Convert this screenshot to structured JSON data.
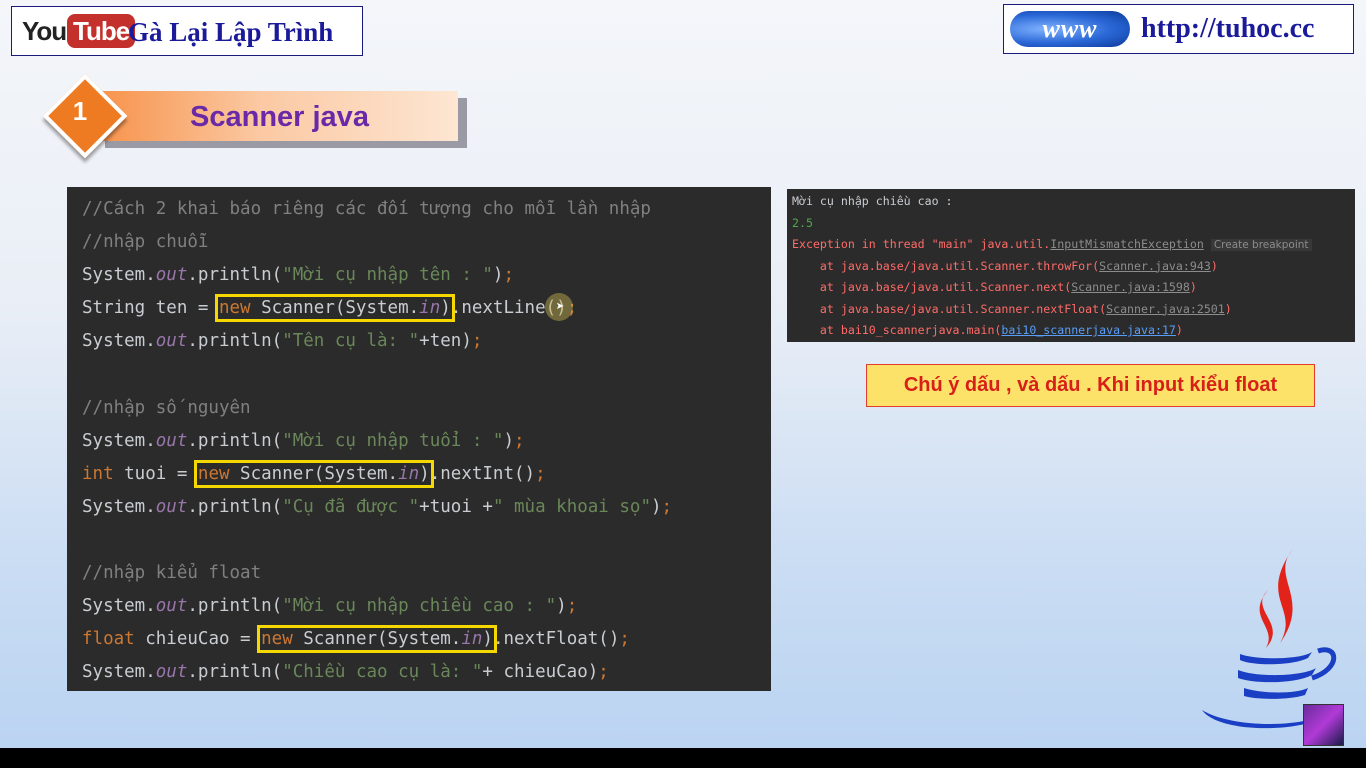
{
  "header": {
    "youtube_you": "You",
    "youtube_tube": "Tube",
    "channel_name": "Gà Lại Lập Trình",
    "www_logo": "www",
    "website_url": "http://tuhoc.cc"
  },
  "badge": {
    "number": "1",
    "title": "Scanner java"
  },
  "code": {
    "lines": [
      "//Cách 2 khai báo riêng các đối tượng cho mỗi lần nhập",
      "//nhập chuỗi",
      "System.out.println(\"Mời cụ nhập tên : \");",
      "String ten = new Scanner(System.in).nextLine();",
      "System.out.println(\"Tên cụ là: \"+ten);",
      "",
      "//nhập số nguyên",
      "System.out.println(\"Mời cụ nhập tuổi : \");",
      "int tuoi = new Scanner(System.in).nextInt();",
      "System.out.println(\"Cụ đã được \"+tuoi +\" mùa khoai sọ\");",
      "",
      "//nhập kiểu float",
      "System.out.println(\"Mời cụ nhập chiều cao : \");",
      "float chieuCao = new Scanner(System.in).nextFloat();",
      "System.out.println(\"Chiều cao cụ là: \"+ chieuCao);"
    ]
  },
  "console": {
    "prompt": "Mời cụ nhập chiều cao :",
    "input": "2.5",
    "exception_prefix": "Exception in thread \"main\" java.util.",
    "exception_class": "InputMismatchException",
    "create_breakpoint": "Create breakpoint",
    "stack": [
      {
        "prefix": "    at java.base/java.util.Scanner.throwFor(",
        "link": "Scanner.java:943",
        "suffix": ")"
      },
      {
        "prefix": "    at java.base/java.util.Scanner.next(",
        "link": "Scanner.java:1598",
        "suffix": ")"
      },
      {
        "prefix": "    at java.base/java.util.Scanner.nextFloat(",
        "link": "Scanner.java:2501",
        "suffix": ")"
      },
      {
        "prefix": "    at bai10_scannerjava.main(",
        "link": "bai10_scannerjava.java:17",
        "suffix": ")"
      }
    ]
  },
  "note": "Chú ý dấu , và dấu . Khi input kiểu float",
  "icons": {
    "java_logo": "java-logo-icon",
    "avatar": "channel-avatar"
  },
  "colors": {
    "highlight": "#f5d800",
    "note_bg": "#fde26a",
    "note_text": "#d8201a",
    "badge_orange": "#ee7a22",
    "title_purple": "#6a2aa8"
  }
}
